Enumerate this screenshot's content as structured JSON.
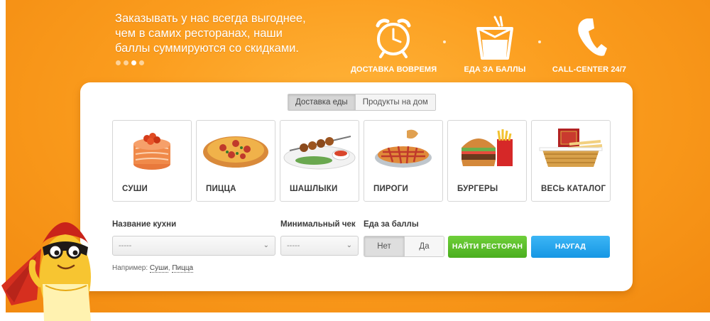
{
  "promo": {
    "text_line1": "Заказывать у нас всегда выгоднее,",
    "text_line2": "чем в самих ресторанах, наши",
    "text_line3": "баллы суммируются со скидками.",
    "slides_count": 4,
    "active_slide": 3
  },
  "features": [
    {
      "label": "ДОСТАВКА ВОВРЕМЯ",
      "icon": "alarm-clock-icon"
    },
    {
      "label": "ЕДА ЗА БАЛЛЫ",
      "icon": "takeout-box-icon"
    },
    {
      "label": "CALL-CENTER 24/7",
      "icon": "phone-handset-icon"
    }
  ],
  "tabs": [
    {
      "label": "Доставка еды",
      "active": true
    },
    {
      "label": "Продукты на дом",
      "active": false
    }
  ],
  "categories": [
    {
      "label": "СУШИ",
      "icon": "sushi-roll-icon"
    },
    {
      "label": "ПИЦЦА",
      "icon": "pizza-icon"
    },
    {
      "label": "ШАШЛЫКИ",
      "icon": "kebab-plate-icon"
    },
    {
      "label": "ПИРОГИ",
      "icon": "pie-icon"
    },
    {
      "label": "БУРГЕРЫ",
      "icon": "burger-fries-icon"
    },
    {
      "label": "ВЕСЬ КАТАЛОГ",
      "icon": "catalog-basket-icon"
    }
  ],
  "filters": {
    "cuisine_label": "Название кухни",
    "cuisine_value": "-----",
    "min_check_label": "Минимальный чек",
    "min_check_value": "-----",
    "points_label": "Еда за баллы",
    "points_no": "Нет",
    "points_yes": "Да",
    "points_selected": "Нет"
  },
  "buttons": {
    "find": "НАЙТИ РЕСТОРАН",
    "random": "НАУГАД"
  },
  "example": {
    "prefix": "Например:",
    "link1": "Суши",
    "separator": ",",
    "link2": "Пицца"
  },
  "colors": {
    "hero_orange": "#fb9d1e",
    "find_green": "#4aae1e",
    "random_blue": "#1697e4"
  }
}
